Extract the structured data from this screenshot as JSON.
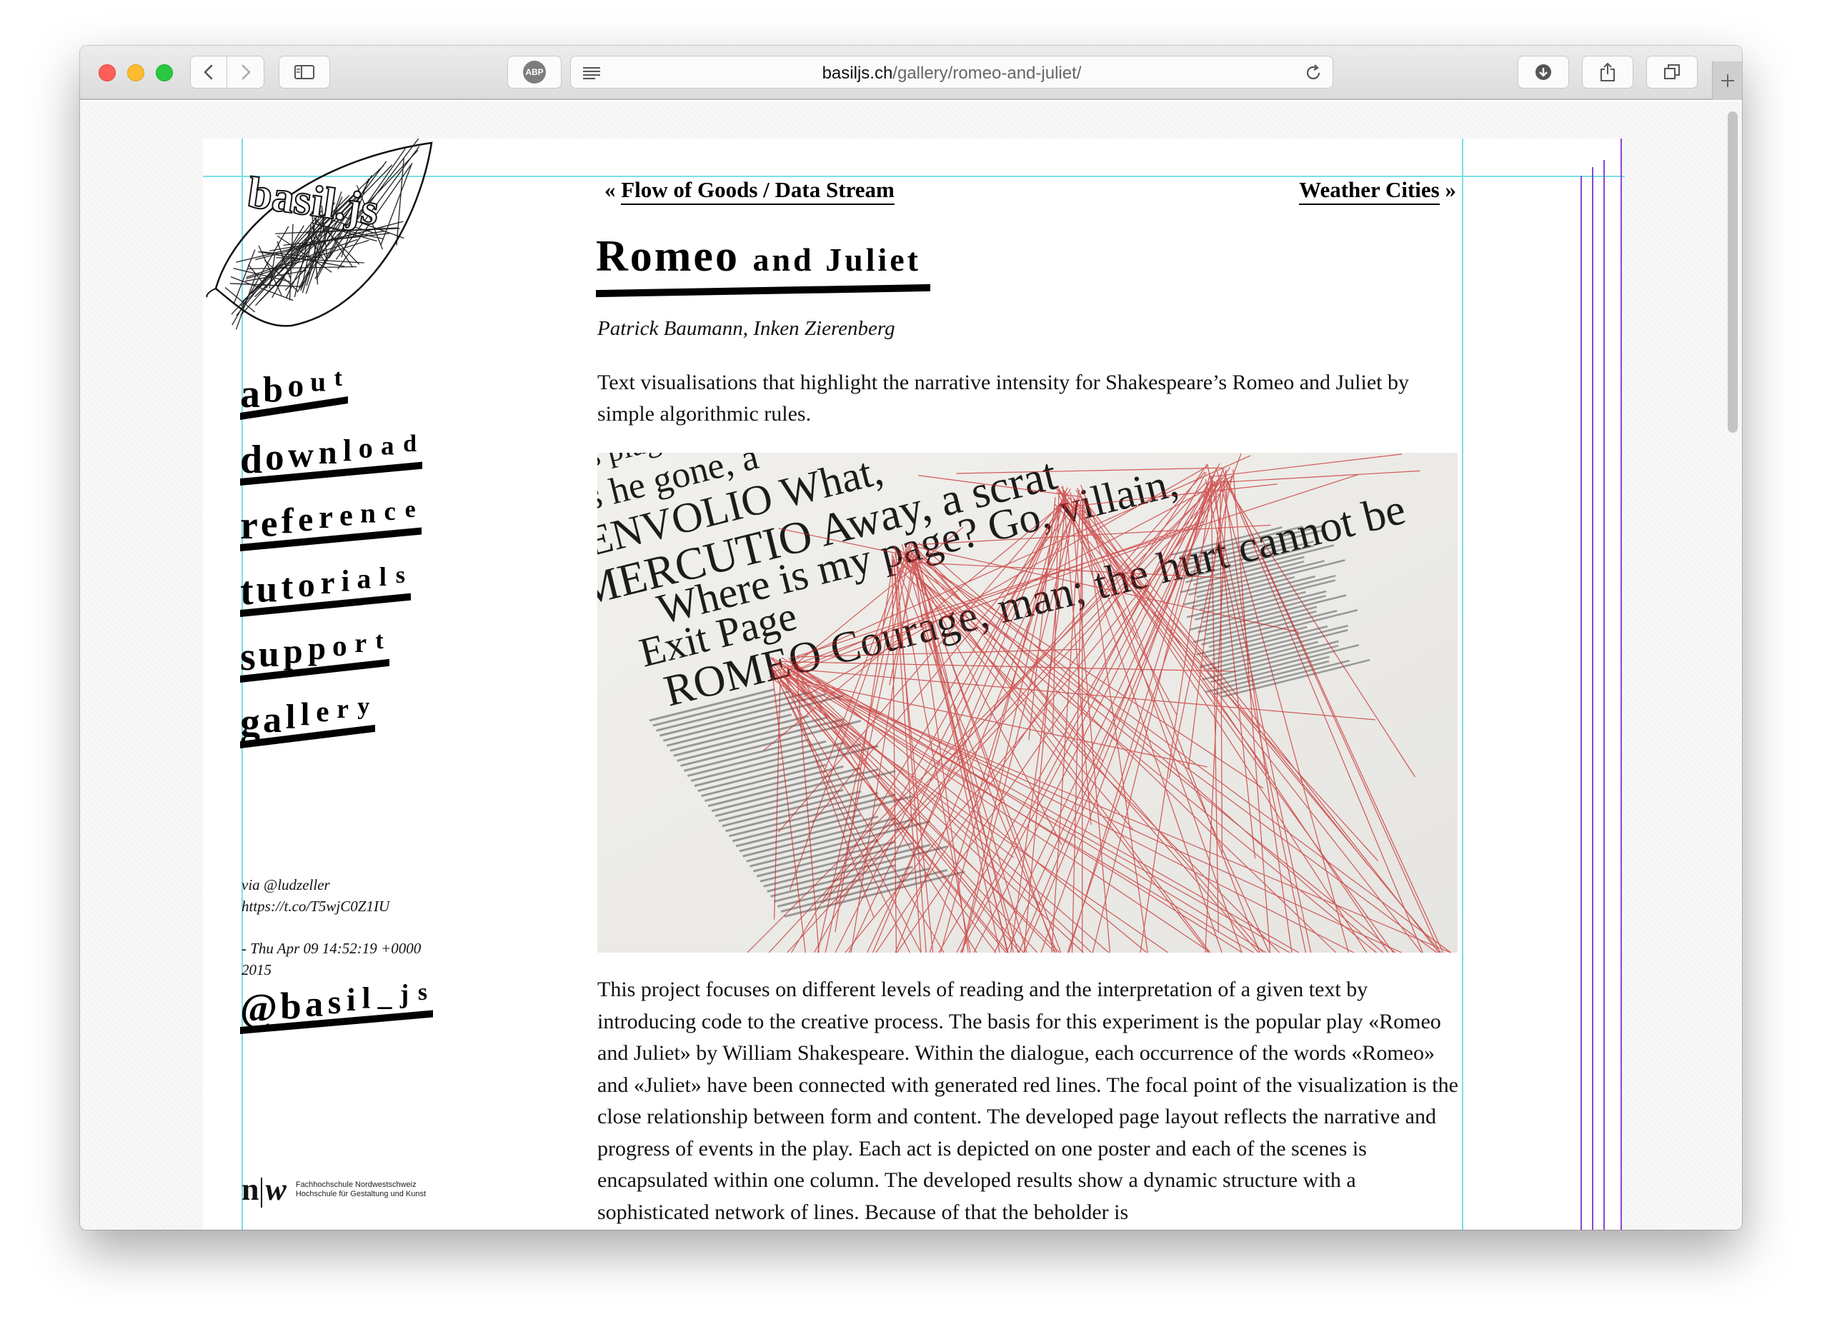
{
  "browser": {
    "url_host": "basiljs.ch",
    "url_path": "/gallery/romeo-and-juliet/",
    "adblock_label": "ABP"
  },
  "site": {
    "logo_text": "basil.js",
    "nav": [
      {
        "label": "about"
      },
      {
        "label": "download"
      },
      {
        "label": "reference"
      },
      {
        "label": "tutorials"
      },
      {
        "label": "support"
      },
      {
        "label": "gallery"
      }
    ],
    "tweet": {
      "line1": "via @ludzeller",
      "line2": "https://t.co/T5wjC0Z1IU",
      "date_line1": "- Thu Apr 09 14:52:19 +0000",
      "date_line2": "2015"
    },
    "twitter_handle": "@basil_js",
    "fhnw": {
      "mark_left": "n",
      "mark_right": "w",
      "line1": "Fachhochschule Nordwestschweiz",
      "line2": "Hochschule für Gestaltung und Kunst"
    }
  },
  "article": {
    "prev_prefix": "« ",
    "prev_label": "Flow of Goods / Data Stream",
    "next_label": "Weather Cities",
    "next_suffix": " »",
    "title_part1": "Romeo ",
    "title_part2": "and Juliet",
    "author1": "Patrick Baumann",
    "author_sep": ", ",
    "author2": "Inken Zierenberg",
    "intro": "Text visualisations that highlight the narrative intensity for Shakespeare’s Romeo and Juliet by simple algorithmic rules.",
    "hero_words": [
      "s plag",
      "s he gone, a",
      "ENVOLIO What,",
      "MERCUTIO Away, a scrat",
      "Where is my page? Go, villain,",
      "Exit Page",
      "ROMEO Courage, man; the hurt cannot be"
    ],
    "body": "This project focuses on different levels of reading and the interpretation of a given text by introducing code to the creative process. The basis for this experiment is the popular play «Romeo and Juliet» by William Shakespeare. Within the dialogue, each occurrence of the words «Romeo» and «Juliet» have been connected with generated red lines. The focal point of the visualization is the close relationship between form and content. The developed page layout reflects the narrative and progress of events in the play. Each act is depicted on one poster and each of the scenes is encapsulated within one column. The developed results show a dynamic structure with a sophisticated network of lines. Because of that the beholder is"
  }
}
